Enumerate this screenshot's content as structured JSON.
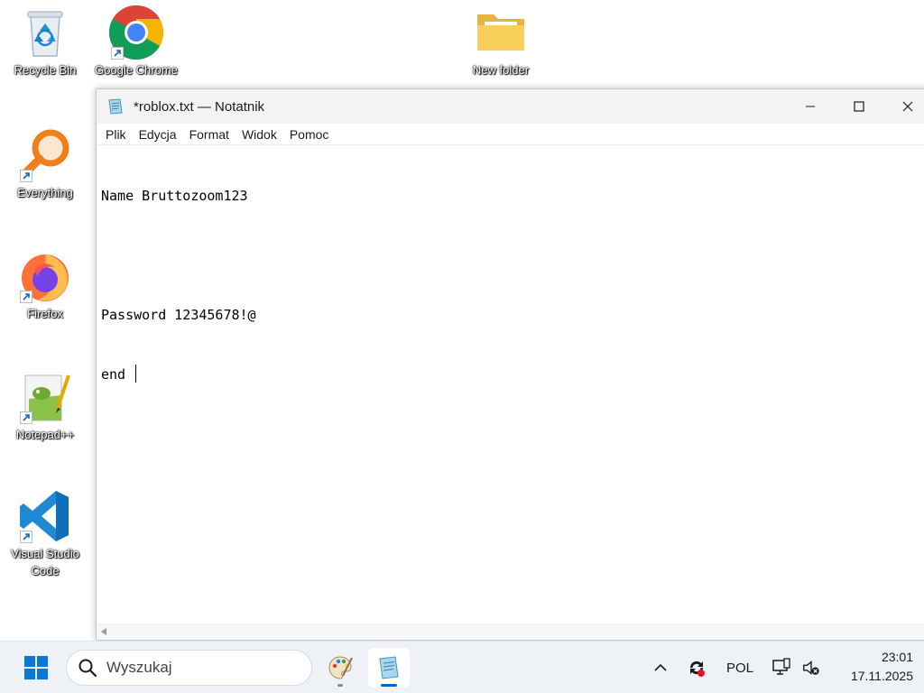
{
  "desktop": {
    "icons": [
      {
        "label": "Recycle Bin"
      },
      {
        "label": "Google Chrome"
      },
      {
        "label": "New folder"
      },
      {
        "label": "Everything"
      },
      {
        "label": "Firefox"
      },
      {
        "label": "Notepad++"
      },
      {
        "label": "Visual Studio Code"
      }
    ]
  },
  "window": {
    "title": "*roblox.txt — Notatnik",
    "menu": [
      "Plik",
      "Edycja",
      "Format",
      "Widok",
      "Pomoc"
    ],
    "content": [
      "Name Bruttozoom123",
      "",
      "Password 12345678!@",
      "end "
    ]
  },
  "taskbar": {
    "search_placeholder": "Wyszukaj",
    "language": "POL",
    "time": "23:01",
    "date": "17.11.2025"
  },
  "colors": {
    "accent": "#0067c0",
    "taskbar_bg": "#eef1f6"
  }
}
